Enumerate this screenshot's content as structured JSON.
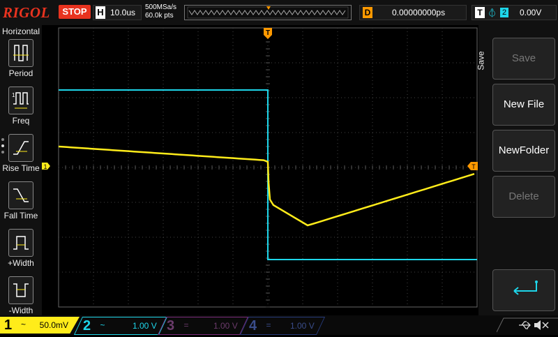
{
  "topbar": {
    "logo": "RIGOL",
    "run_state": "STOP",
    "horizontal_label": "H",
    "timebase": "10.0us",
    "sample_rate": "500MSa/s",
    "memory_depth": "60.0k pts",
    "delay_label": "D",
    "delay_value": "0.00000000ps",
    "trigger_label": "T",
    "trigger_source": "2",
    "trigger_level": "0.00V"
  },
  "left_menu": {
    "title": "Horizontal",
    "items": [
      {
        "label": "Period",
        "icon": "period-icon"
      },
      {
        "label": "Freq",
        "icon": "freq-icon"
      },
      {
        "label": "Rise Time",
        "icon": "rise-time-icon"
      },
      {
        "label": "Fall Time",
        "icon": "fall-time-icon"
      },
      {
        "label": "+Width",
        "icon": "positive-width-icon"
      },
      {
        "label": "-Width",
        "icon": "negative-width-icon"
      }
    ]
  },
  "right_menu": {
    "title": "Save",
    "buttons": [
      {
        "label": "Save",
        "enabled": false
      },
      {
        "label": "New File",
        "enabled": true
      },
      {
        "label": "NewFolder",
        "enabled": true
      },
      {
        "label": "Delete",
        "enabled": false
      },
      {
        "label": "",
        "icon": "enter-return-icon",
        "enabled": true
      }
    ]
  },
  "screen": {
    "trigger_position_marker": "T",
    "ch1_marker": "1",
    "trigger_level_marker": "T"
  },
  "channels": [
    {
      "num": "1",
      "coupling": "~",
      "scale": "50.0mV",
      "color": "#ffec1a",
      "active": true
    },
    {
      "num": "2",
      "coupling": "~",
      "scale": "1.00 V",
      "color": "#1ed6ea",
      "active": true
    },
    {
      "num": "3",
      "coupling": "=",
      "scale": "1.00 V",
      "color": "#7a2a7a",
      "active": false
    },
    {
      "num": "4",
      "coupling": "=",
      "scale": "1.00 V",
      "color": "#253a7a",
      "active": false
    }
  ],
  "status_icons": [
    "usb-icon",
    "speaker-mute-icon"
  ],
  "colors": {
    "ch1": "#ffec1a",
    "ch2": "#1ed6ea",
    "trigger": "#ff9900",
    "stop": "#e8331f"
  }
}
